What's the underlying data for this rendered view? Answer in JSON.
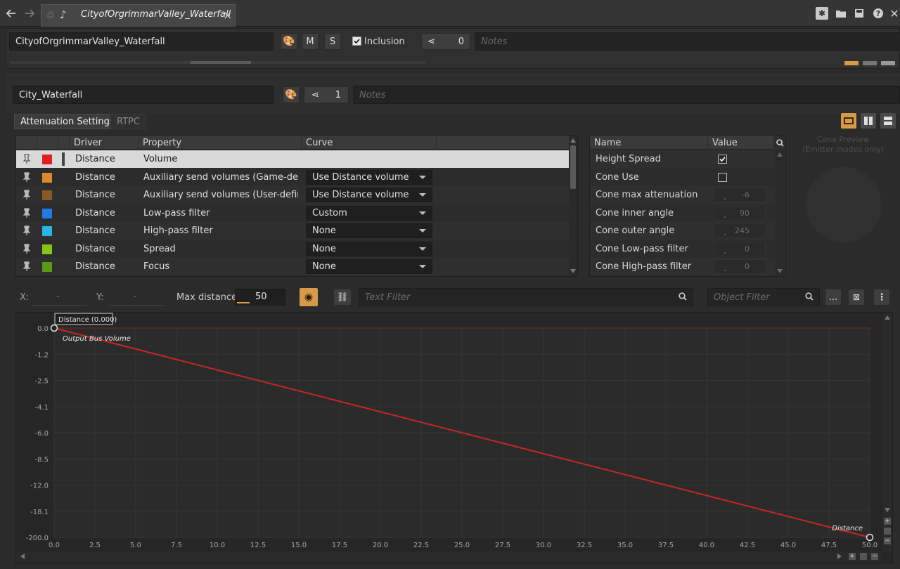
{
  "titlebar": {
    "tab_title": "CityofOrgrimmarValley_Waterfall",
    "close_glyph": "×"
  },
  "object_bar": {
    "name_value": "CityofOrgrimmarValley_Waterfall",
    "mute_label": "M",
    "solo_label": "S",
    "inclusion_label": "Inclusion",
    "references_count": "0",
    "notes_placeholder": "Notes"
  },
  "attenuation_bar": {
    "name_value": "City_Waterfall",
    "references_count": "1",
    "notes_placeholder": "Notes"
  },
  "tabs": [
    {
      "label": "Attenuation Settings",
      "active": true
    },
    {
      "label": "RTPC",
      "active": false
    }
  ],
  "curve_table": {
    "headers": {
      "driver": "Driver",
      "property": "Property",
      "curve": "Curve"
    },
    "rows": [
      {
        "driver": "Distance",
        "property": "Volume",
        "curve": "",
        "color": "#e02020",
        "selected": true
      },
      {
        "driver": "Distance",
        "property": "Auxiliary send volumes (Game-defi...",
        "curve": "Use Distance volume",
        "color": "#d98a2e"
      },
      {
        "driver": "Distance",
        "property": "Auxiliary send volumes (User-defin...",
        "curve": "Use Distance volume",
        "color": "#8a5a26"
      },
      {
        "driver": "Distance",
        "property": "Low-pass filter",
        "curve": "Custom",
        "color": "#1e7be0"
      },
      {
        "driver": "Distance",
        "property": "High-pass filter",
        "curve": "None",
        "color": "#2ab5ea"
      },
      {
        "driver": "Distance",
        "property": "Spread",
        "curve": "None",
        "color": "#86c41a"
      },
      {
        "driver": "Distance",
        "property": "Focus",
        "curve": "None",
        "color": "#5a9a18"
      }
    ]
  },
  "cone_table": {
    "headers": {
      "name": "Name",
      "value": "Value"
    },
    "rows": [
      {
        "name": "Height Spread",
        "type": "check",
        "checked": true
      },
      {
        "name": "Cone Use",
        "type": "check",
        "checked": false
      },
      {
        "name": "Cone max attenuation",
        "type": "num",
        "value": "-6"
      },
      {
        "name": "Cone inner angle",
        "type": "num",
        "value": "90"
      },
      {
        "name": "Cone outer angle",
        "type": "num",
        "value": "245"
      },
      {
        "name": "Cone Low-pass filter",
        "type": "num",
        "value": "0"
      },
      {
        "name": "Cone High-pass filter",
        "type": "num",
        "value": "0"
      }
    ]
  },
  "cone_preview": {
    "title": "Cone Preview",
    "subtitle": "(Emitter modes only)"
  },
  "curve_toolbar": {
    "x_label": "X:",
    "x_value": "-",
    "y_label": "Y:",
    "y_value": "-",
    "max_distance_label": "Max distance",
    "max_distance_value": "50",
    "text_filter_placeholder": "Text Filter",
    "object_filter_placeholder": "Object Filter",
    "more_label": "..."
  },
  "chart_data": {
    "type": "line",
    "title": "",
    "xlabel": "Distance",
    "ylabel": "",
    "xlim": [
      0,
      50
    ],
    "y_ticks": [
      "0.0",
      "-1.2",
      "-2.5",
      "-4.1",
      "-6.0",
      "-8.5",
      "-12.0",
      "-18.1",
      "-200.0"
    ],
    "x_ticks": [
      "0.0",
      "2.5",
      "5.0",
      "7.5",
      "10.0",
      "12.5",
      "15.0",
      "17.5",
      "20.0",
      "22.5",
      "25.0",
      "27.5",
      "30.0",
      "32.5",
      "35.0",
      "37.5",
      "40.0",
      "42.5",
      "45.0",
      "47.5",
      "50.0"
    ],
    "series": [
      {
        "name": "Output Bus Volume",
        "color": "#c62828",
        "x": [
          0,
          50
        ],
        "y": [
          "0.0",
          "-200.0"
        ]
      }
    ],
    "point_label": "Distance (0.000)",
    "grid": true
  }
}
